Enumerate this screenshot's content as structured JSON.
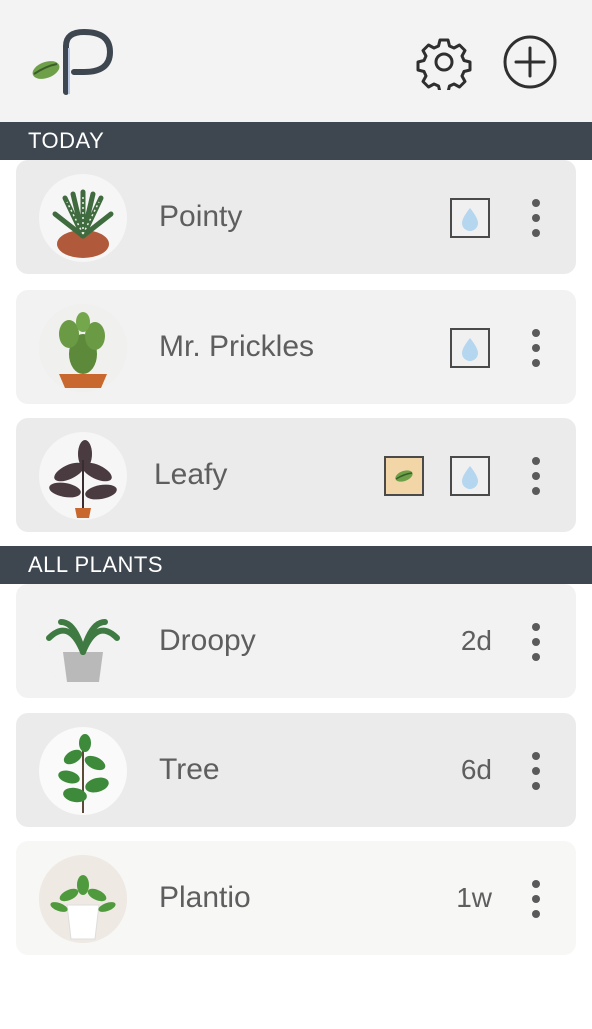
{
  "app": {
    "logo_letter": "P",
    "colors": {
      "header_bg": "#3e4750",
      "card_bg": "#f2f2f2",
      "water": "#b4d6ef",
      "fertilizer": "#f3d6a8",
      "leaf_green": "#6da048"
    }
  },
  "toolbar": {
    "settings_icon": "gear-icon",
    "add_icon": "plus-circle-icon"
  },
  "today": {
    "label": "TODAY",
    "plants": [
      {
        "name": "Pointy",
        "tasks": [
          "water"
        ]
      },
      {
        "name": "Mr. Prickles",
        "tasks": [
          "water"
        ]
      },
      {
        "name": "Leafy",
        "tasks": [
          "fertilize",
          "water"
        ]
      }
    ]
  },
  "all_plants": {
    "label": "ALL PLANTS",
    "plants": [
      {
        "name": "Droopy",
        "age": "2d"
      },
      {
        "name": "Tree",
        "age": "6d"
      },
      {
        "name": "Plantio",
        "age": "1w"
      }
    ]
  }
}
